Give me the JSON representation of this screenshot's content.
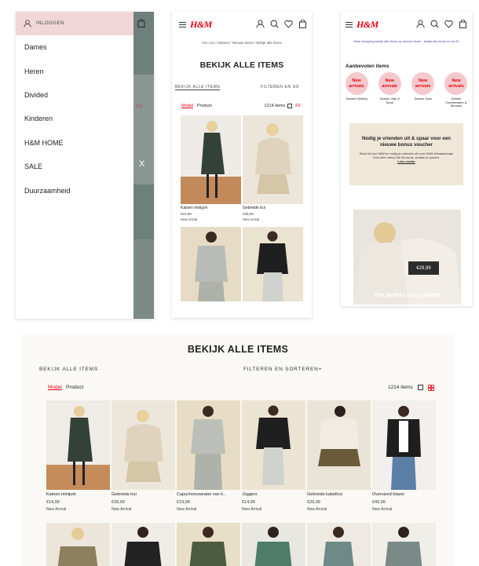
{
  "menu": {
    "login_label": "INLOGGEN",
    "items": [
      "Dames",
      "Heren",
      "Divided",
      "Kinderen",
      "H&M HOME",
      "SALE",
      "Duurzaamheid"
    ],
    "close": "X",
    "side_ff": "FF"
  },
  "brand": {
    "logo": "H&M",
    "accent": "#e50010"
  },
  "mobile_listing": {
    "breadcrumb": "Hm.com / Dames / Nieuwe items / Bekijk alle items",
    "title": "BEKIJK ALLE ITEMS",
    "tab_all": "BEKIJK ALLE ITEMS",
    "tab_filter": "FILTEREN EN SO",
    "model": "Model",
    "product": "Product",
    "count": "1214 items",
    "ff": "FF",
    "products": [
      {
        "name": "Katoen minijurk",
        "price": "€19,99",
        "tag": "New Arrival"
      },
      {
        "name": "Gebreide trui",
        "price": "€39,99",
        "tag": "New Arrival"
      },
      {
        "name": "",
        "price": "",
        "tag": ""
      },
      {
        "name": "",
        "price": "",
        "tag": ""
      }
    ]
  },
  "mobile_recommended": {
    "ticker": "Meer shopping bekijk alle items op nieuwe items · bekijk alle items nu tot 25",
    "title": "Aanbevolen items",
    "circles": [
      {
        "text1": "New",
        "text2": "arrivals",
        "label": "Dames Kleding"
      },
      {
        "text1": "New",
        "text2": "arrivals",
        "label": "Dames Vrije & Sport"
      },
      {
        "text1": "New",
        "text2": "arrivals",
        "label": "Dames Tops"
      },
      {
        "text1": "New",
        "text2": "arrivals",
        "label": "Dames Overhemden & Blouses"
      }
    ],
    "voucher_heading": "Nodig je vrienden uit & spaar voor een nieuwe bonus voucher",
    "voucher_body": "Word lid van H&M en nodig je vrienden uit voor H&M-lidmaatschap! Voor elke vriend die lid wordt, verdien je punten.",
    "voucher_link": "Lees verder",
    "promo_price": "€29,99",
    "promo_text": "The perfect cozy palette"
  },
  "desktop": {
    "title": "BEKIJK ALLE ITEMS",
    "tab_all": "BEKIJK ALLE ITEMS",
    "tab_filter": "FILTEREN EN SORTEREN+",
    "model": "Model",
    "product": "Product",
    "count": "1214 items",
    "products": [
      {
        "name": "Katoen minijurk",
        "price": "€19,99",
        "tag": "New Arrival"
      },
      {
        "name": "Gebreide trui",
        "price": "€39,99",
        "tag": "New Arrival"
      },
      {
        "name": "Capuchonsweater van k...",
        "price": "€19,99",
        "tag": "New Arrival"
      },
      {
        "name": "Joggers",
        "price": "€14,99",
        "tag": "New Arrival"
      },
      {
        "name": "Gebreide kabeltrui",
        "price": "€29,99",
        "tag": "New Arrival"
      },
      {
        "name": "Oversized blazer",
        "price": "€49,99",
        "tag": "New Arrival"
      }
    ]
  },
  "colors": {
    "brand_red": "#e50010",
    "menu_pink": "#f1d6d8",
    "circle_pink": "#f4c9cd",
    "voucher_bg": "#efe7d8",
    "overlay_teal": "#6f7f7c"
  }
}
